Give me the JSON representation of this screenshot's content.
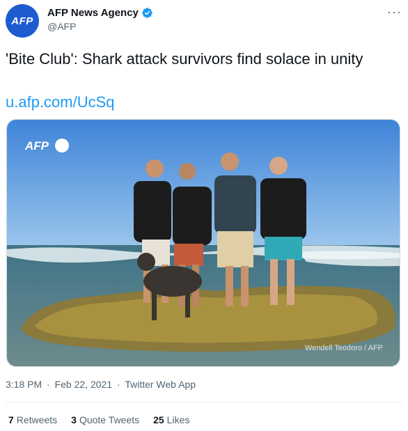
{
  "author": {
    "avatar_text": "AFP",
    "display_name": "AFP News Agency",
    "handle": "@AFP",
    "verified_icon": "verified-badge-icon",
    "brand_color": "#1d5bd1"
  },
  "more_icon": "more-options-icon",
  "tweet": {
    "text": "'Bite Club': Shark attack survivors find solace in unity",
    "link": "u.afp.com/UcSq",
    "link_color": "#1d9bf0"
  },
  "media": {
    "watermark": "AFP",
    "credit": "Wendell Teodoro / AFP"
  },
  "meta": {
    "time": "3:18 PM",
    "date": "Feb 22, 2021",
    "source": "Twitter Web App",
    "separator": "·"
  },
  "stats": {
    "retweets_count": "7",
    "retweets_label": "Retweets",
    "quotes_count": "3",
    "quotes_label": "Quote Tweets",
    "likes_count": "25",
    "likes_label": "Likes"
  }
}
